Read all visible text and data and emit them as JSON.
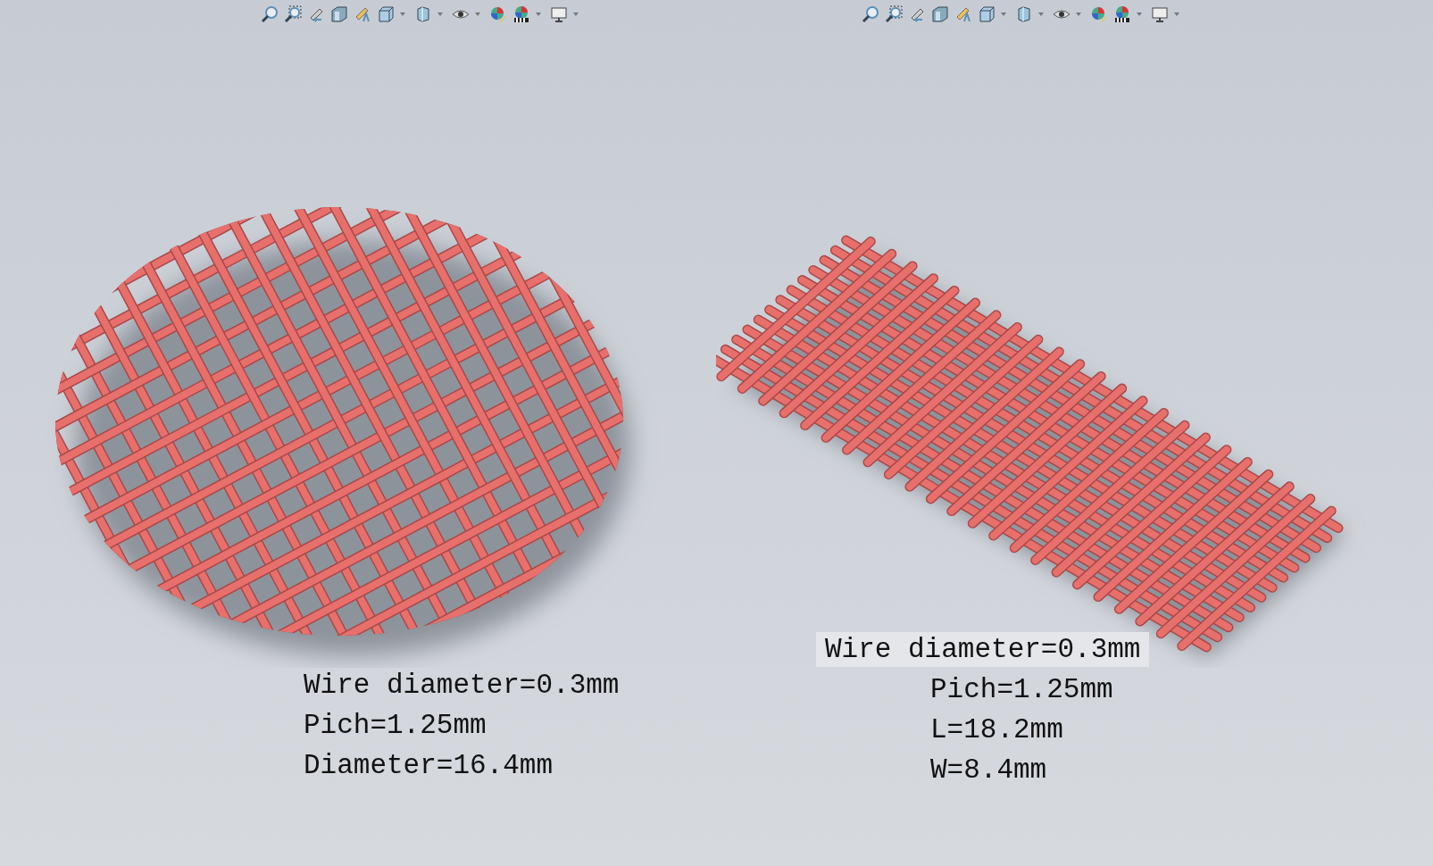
{
  "viewports": [
    {
      "model": {
        "kind": "circle"
      },
      "specs": [
        {
          "text": "Wire diameter=0.3mm",
          "highlighted": false
        },
        {
          "text": "Pich=1.25mm",
          "highlighted": false
        },
        {
          "text": "Diameter=16.4mm",
          "highlighted": false
        }
      ]
    },
    {
      "model": {
        "kind": "rectangle"
      },
      "specs": [
        {
          "text": "Wire diameter=0.3mm",
          "highlighted": true
        },
        {
          "text": "Pich=1.25mm",
          "highlighted": false
        },
        {
          "text": "L=18.2mm",
          "highlighted": false
        },
        {
          "text": "W=8.4mm",
          "highlighted": false
        }
      ]
    }
  ]
}
